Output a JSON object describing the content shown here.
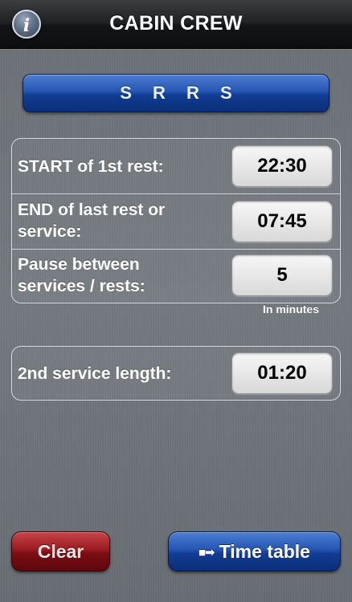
{
  "header": {
    "title": "CABIN CREW",
    "info_icon": "info-icon",
    "info_glyph": "i"
  },
  "mode": {
    "label": "S R R S"
  },
  "rows": [
    {
      "label_line1": "START of 1st rest:",
      "label_line2": "",
      "value": "22:30"
    },
    {
      "label_line1": "END of last rest or",
      "label_line2": "service:",
      "value": "07:45"
    },
    {
      "label_line1": "Pause between",
      "label_line2": "services / rests:",
      "value": "5"
    }
  ],
  "hint": "In minutes",
  "service": {
    "label": "2nd service length:",
    "value": "01:20"
  },
  "buttons": {
    "clear_label": "Clear",
    "timetable_icon": "arrow-right-icon",
    "timetable_glyph": "■➡",
    "timetable_label": "Time table"
  },
  "colors": {
    "background": "#6e7379",
    "header": "#141516",
    "accent_blue": "#2456b3",
    "clear_red": "#9a1c22"
  }
}
